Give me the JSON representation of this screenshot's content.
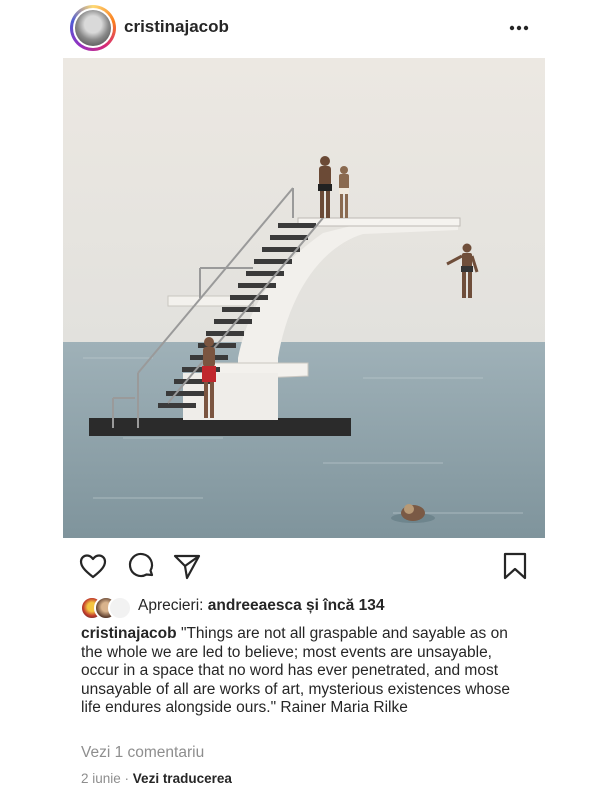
{
  "post": {
    "username": "cristinajacob",
    "image_description": "photo"
  },
  "likes": {
    "prefix": "Aprecieri: ",
    "liker": "andreeaesca",
    "suffix": " și încă 134"
  },
  "caption": {
    "username": "cristinajacob",
    "text": "\"Things are not all graspable and sayable as on the whole we are led to believe; most events are unsayable, occur in a space that no word has ever penetrated, and most unsayable of all are works of art, mysterious existences whose life endures alongside ours.\" Rainer Maria Rilke"
  },
  "comments": {
    "link": "Vezi 1 comentariu"
  },
  "meta": {
    "date": "2 iunie",
    "separator": " · ",
    "translate": "Vezi traducerea"
  },
  "icons": {
    "more": "more-horizontal-icon",
    "like": "heart-icon",
    "comment": "comment-icon",
    "share": "paper-plane-icon",
    "save": "bookmark-icon"
  }
}
